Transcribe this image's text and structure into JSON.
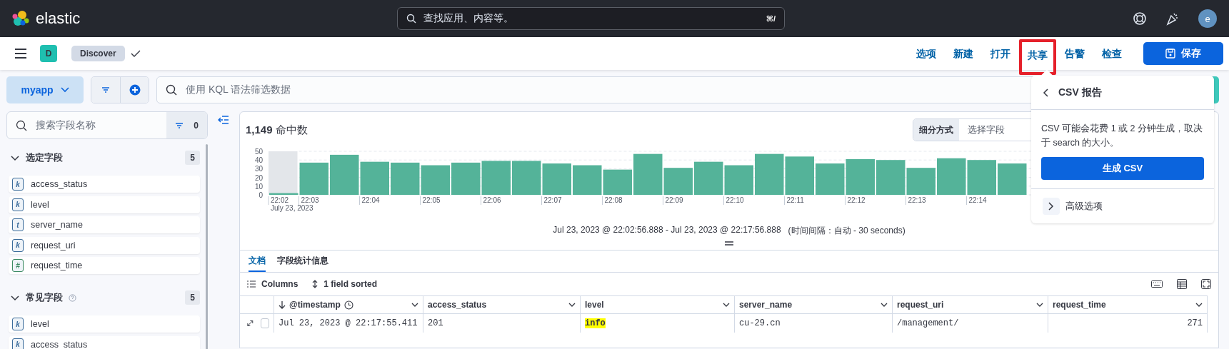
{
  "header": {
    "brand": "elastic",
    "search": {
      "placeholder": "查找应用、内容等。",
      "shortcut": "⌘/"
    },
    "avatar": "e"
  },
  "app_bar": {
    "space_badge": "D",
    "breadcrumb": "Discover",
    "nav": [
      {
        "label": "选项",
        "highlighted": false
      },
      {
        "label": "新建",
        "highlighted": false
      },
      {
        "label": "打开",
        "highlighted": false
      },
      {
        "label": "共享",
        "highlighted": true
      },
      {
        "label": "告警",
        "highlighted": false
      },
      {
        "label": "检查",
        "highlighted": false
      }
    ],
    "save_button": "保存"
  },
  "query_bar": {
    "data_view": "myapp",
    "placeholder": "使用 KQL 语法筛选数据"
  },
  "sidebar": {
    "search_placeholder": "搜索字段名称",
    "filter_count": "0",
    "sections": [
      {
        "title": "选定字段",
        "count": "5",
        "help": false,
        "expanded": true,
        "fields": [
          {
            "color": "#3b6c9b",
            "token": "k",
            "name": "access_status"
          },
          {
            "color": "#3b6c9b",
            "token": "k",
            "name": "level"
          },
          {
            "color": "#3b6c9b",
            "token": "t",
            "name": "server_name"
          },
          {
            "color": "#3b6c9b",
            "token": "k",
            "name": "request_uri"
          },
          {
            "color": "#3c8a63",
            "token": "#",
            "name": "request_time"
          }
        ]
      },
      {
        "title": "常见字段",
        "count": "5",
        "help": true,
        "expanded": true,
        "fields": [
          {
            "color": "#3b6c9b",
            "token": "k",
            "name": "level"
          },
          {
            "color": "#3b6c9b",
            "token": "k",
            "name": "access_status"
          }
        ]
      }
    ]
  },
  "histogram": {
    "hits": "1,149",
    "hits_label": "命中数",
    "breakdown_label": "细分方式",
    "breakdown_placeholder": "选择字段",
    "date_caption": "July 23, 2023",
    "chart_data": {
      "type": "bar",
      "grid": true,
      "ylim": [
        0,
        50
      ],
      "yticks": [
        0,
        10,
        20,
        30,
        40,
        50
      ],
      "categories": [
        "22:02",
        "22:03",
        null,
        "22:04",
        null,
        "22:05",
        null,
        "22:06",
        null,
        "22:07",
        null,
        "22:08",
        null,
        "22:09",
        null,
        "22:10",
        null,
        "22:11",
        null,
        "22:12",
        null,
        "22:13",
        null,
        "22:14",
        null
      ],
      "series": [
        {
          "color": "#54b399",
          "values": [
            2,
            37,
            46,
            38,
            37,
            34,
            37,
            39,
            39,
            36,
            34,
            29,
            47,
            31,
            38,
            34,
            47,
            44,
            36,
            41,
            40,
            31,
            42,
            40,
            36
          ]
        }
      ]
    },
    "range": "Jul 23, 2023 @ 22:02:56.888 - Jul 23, 2023 @ 22:17:56.888",
    "interval": "(时间间隔：自动 - 30 seconds)"
  },
  "tabs": [
    {
      "label": "文档",
      "selected": true
    },
    {
      "label": "字段统计信息",
      "selected": false
    }
  ],
  "toolbar": {
    "columns": "Columns",
    "sorted": "1 field sorted"
  },
  "table": {
    "columns": [
      {
        "label": "@timestamp",
        "kind": "time",
        "sorted": true
      },
      {
        "label": "access_status",
        "kind": "text",
        "sorted": false
      },
      {
        "label": "level",
        "kind": "text",
        "sorted": false
      },
      {
        "label": "server_name",
        "kind": "text",
        "sorted": false
      },
      {
        "label": "request_uri",
        "kind": "text",
        "sorted": false
      },
      {
        "label": "request_time",
        "kind": "number",
        "sorted": false
      }
    ],
    "rows": [
      {
        "checked": false,
        "cells": [
          {
            "text": "Jul 23, 2023 @ 22:17:55.411",
            "highlighted": false
          },
          {
            "text": "201",
            "highlighted": false
          },
          {
            "text": "info",
            "highlighted": true
          },
          {
            "text": "cu-29.cn",
            "highlighted": false
          },
          {
            "text": "/management/",
            "highlighted": false
          },
          {
            "text": "271",
            "highlighted": false
          }
        ]
      }
    ]
  },
  "popover": {
    "title": "CSV 报告",
    "description": "CSV 可能会花费 1 或 2 分钟生成，取决于 search 的大小。",
    "generate_button": "生成 CSV",
    "advanced": "高级选项"
  }
}
